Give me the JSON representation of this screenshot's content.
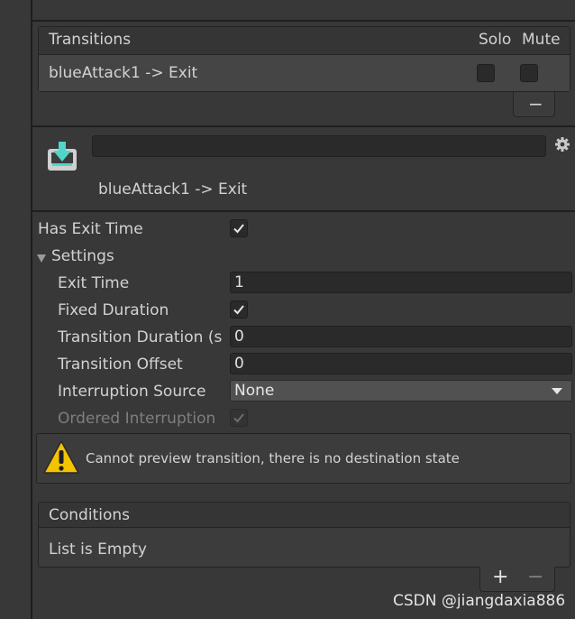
{
  "transitions": {
    "header": "Transitions",
    "solo_label": "Solo",
    "mute_label": "Mute",
    "items": [
      {
        "label": "blueAttack1 -> Exit",
        "solo": false,
        "mute": false
      }
    ],
    "remove_label": "−"
  },
  "transition_header": {
    "name_value": "",
    "title": "blueAttack1 -> Exit"
  },
  "settings": {
    "has_exit_time_label": "Has Exit Time",
    "has_exit_time": true,
    "section_label": "Settings",
    "exit_time_label": "Exit Time",
    "exit_time_value": "1",
    "fixed_duration_label": "Fixed Duration",
    "fixed_duration": true,
    "transition_duration_label": "Transition Duration (s",
    "transition_duration_value": "0",
    "transition_offset_label": "Transition Offset",
    "transition_offset_value": "0",
    "interruption_source_label": "Interruption Source",
    "interruption_source_value": "None",
    "ordered_interruption_label": "Ordered Interruption",
    "ordered_interruption": true
  },
  "warning": {
    "icon": "warning-icon",
    "text": "Cannot preview transition, there is no destination state"
  },
  "conditions": {
    "header": "Conditions",
    "empty_text": "List is Empty",
    "add_label": "+",
    "remove_label": "−"
  },
  "watermark": "CSDN @jiangdaxia886",
  "colors": {
    "background": "#383838",
    "panel_header": "#353535",
    "field": "#2a2a2a",
    "icon_teal": "#4fd6c8",
    "warning_yellow": "#f3c300"
  }
}
